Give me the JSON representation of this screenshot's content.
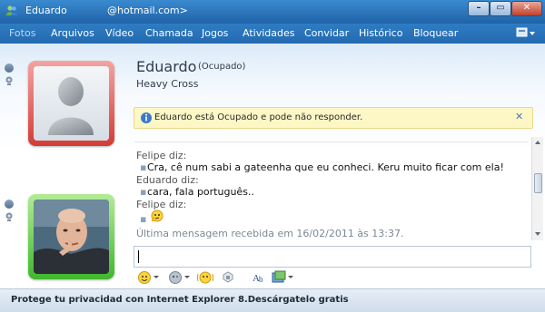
{
  "window": {
    "title": "Eduardo",
    "email": "@hotmail.com>",
    "min_label": "–",
    "max_label": "▭",
    "close_label": "✕"
  },
  "menu": {
    "items": [
      "Fotos",
      "Arquivos",
      "Vídeo",
      "Chamada",
      "Jogos",
      "Atividades",
      "Convidar",
      "Histórico",
      "Bloquear"
    ]
  },
  "contact": {
    "name": "Eduardo",
    "status": "(Ocupado)",
    "personal_message": "Heavy Cross",
    "status_color": "#d33c36"
  },
  "notice": {
    "text": "Eduardo está Ocupado e pode não responder.",
    "close_label": "✕"
  },
  "conversation": {
    "lines": [
      {
        "who": "Felipe diz:",
        "msg": "Cra, cê num sabi a gateenha que eu conheci. Keru muito ficar com ela!"
      },
      {
        "who": "Eduardo diz:",
        "msg": "cara, fala português.."
      },
      {
        "who": "Felipe diz:",
        "msg": ""
      }
    ],
    "last_received": "Última mensagem recebida em 16/02/2011 às 13:37."
  },
  "self": {
    "status_color": "#3fb82c"
  },
  "toolbar": {
    "icons": [
      "emoticon-icon",
      "wink-icon",
      "nudge-icon",
      "voice-clip-icon",
      "font-icon",
      "background-icon"
    ]
  },
  "footer": {
    "ad_text": "Protege tu privacidad con Internet Explorer 8.Descárgatelo gratis"
  }
}
